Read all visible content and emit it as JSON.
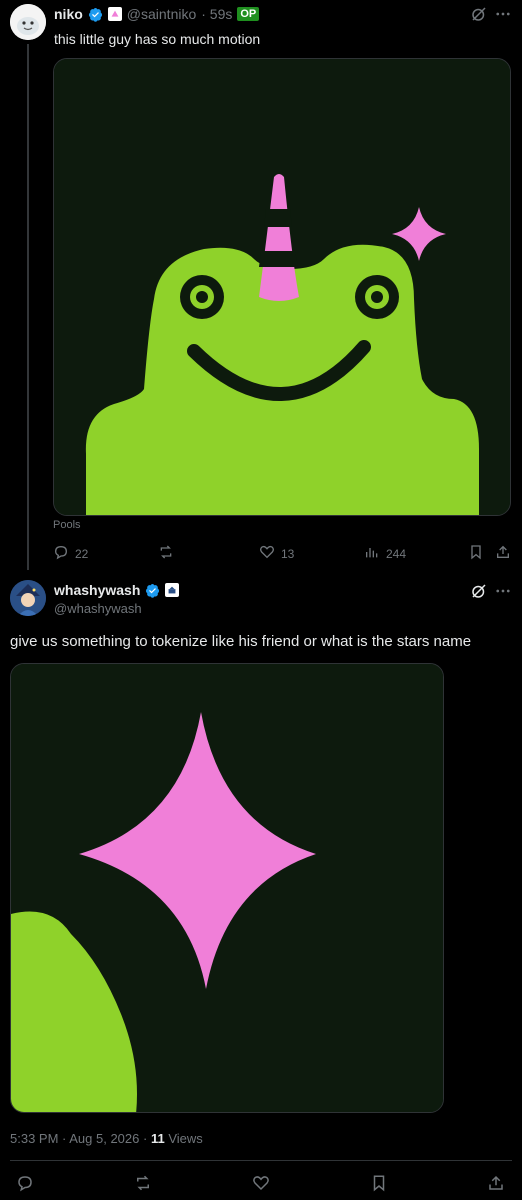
{
  "post1": {
    "display_name": "niko",
    "handle": "@saintniko",
    "time": "· 59s",
    "op_badge": "OP",
    "text": "this little guy has so much motion",
    "media_caption": "Pools",
    "stats": {
      "replies": "22",
      "reposts": "",
      "likes": "13",
      "views": "244"
    }
  },
  "post2": {
    "display_name": "whashywash",
    "handle": "@whashywash",
    "text": "give us something to tokenize like his friend or what is the stars name",
    "meta_time": "5:33 PM · Aug 5, 2026 ·",
    "views_count": "11",
    "views_label": "Views"
  },
  "colors": {
    "background": "#000000",
    "frog_green": "#8fd22a",
    "sparkle_pink": "#f07fd8",
    "media_bg": "#0b1a0b",
    "verified_blue": "#1d9bf0",
    "op_green": "#1f8f1f"
  },
  "icons": [
    "grok-icon",
    "more-icon",
    "reply-icon",
    "repost-icon",
    "like-icon",
    "views-icon",
    "bookmark-icon",
    "share-icon"
  ]
}
